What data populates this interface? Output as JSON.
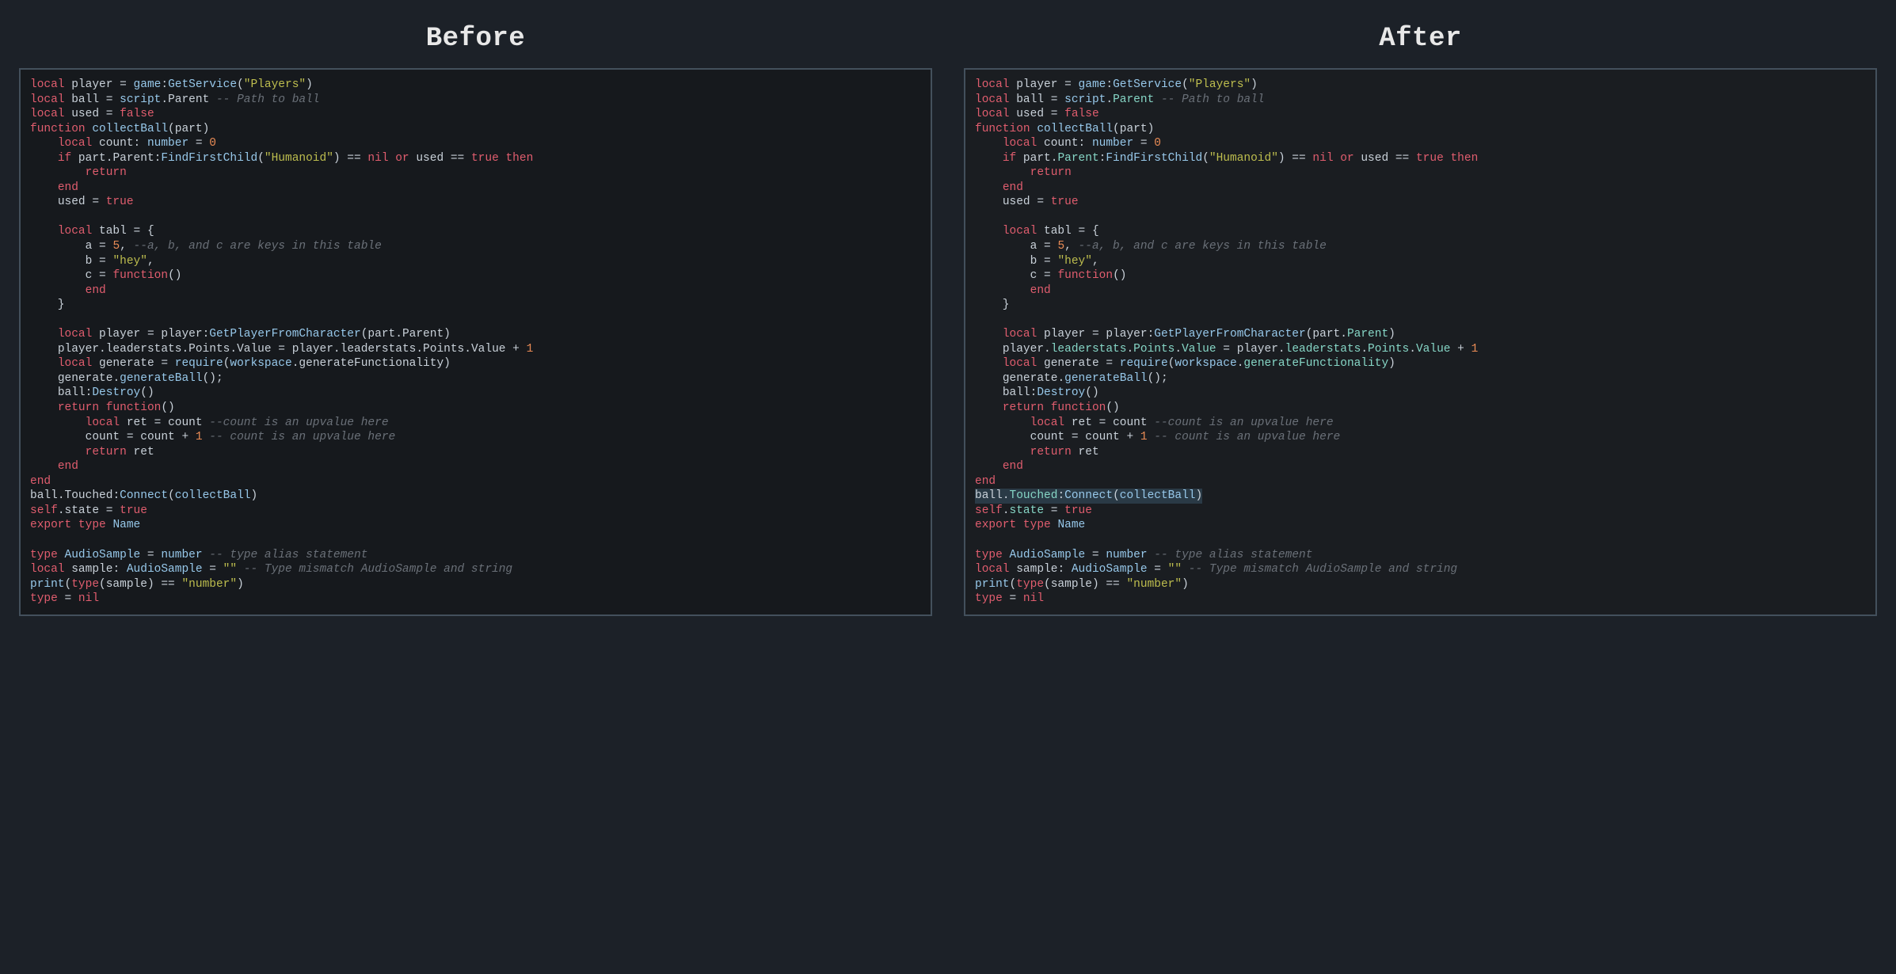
{
  "headings": {
    "before": "Before",
    "after": "After"
  },
  "code_before": {
    "colors": {
      "keyword": "#e05d6e",
      "string": "#bdbd4e",
      "number": "#e98b55",
      "comment": "#6a7078",
      "func": "#97c8ea",
      "default": "#c9d1d9"
    },
    "lines": [
      "local player = game:GetService(\"Players\")",
      "local ball = script.Parent -- Path to ball",
      "local used = false",
      "function collectBall(part)",
      "    local count: number = 0",
      "    if part.Parent:FindFirstChild(\"Humanoid\") == nil or used == true then",
      "        return",
      "    end",
      "    used = true",
      "",
      "    local tabl = {",
      "        a = 5, --a, b, and c are keys in this table",
      "        b = \"hey\",",
      "        c = function()",
      "        end",
      "    }",
      "",
      "    local player = player:GetPlayerFromCharacter(part.Parent)",
      "    player.leaderstats.Points.Value = player.leaderstats.Points.Value + 1",
      "    local generate = require(workspace.generateFunctionality)",
      "    generate.generateBall();",
      "    ball:Destroy()",
      "    return function()",
      "        local ret = count --count is an upvalue here",
      "        count = count + 1 -- count is an upvalue here",
      "        return ret",
      "    end",
      "end",
      "ball.Touched:Connect(collectBall)",
      "self.state = true",
      "export type Name",
      "",
      "type AudioSample = number -- type alias statement",
      "local sample: AudioSample = \"\" -- Type mismatch AudioSample and string",
      "print(type(sample) == \"number\")",
      "type = nil"
    ]
  },
  "code_after": {
    "colors": {
      "keyword": "#e05d6e",
      "string": "#bdbd4e",
      "number": "#e98b55",
      "comment": "#6a7078",
      "func": "#97c8ea",
      "property": "#86d6c6",
      "default": "#c9d1d9"
    },
    "highlighted_line_index": 28,
    "lines": [
      "local player = game:GetService(\"Players\")",
      "local ball = script.Parent -- Path to ball",
      "local used = false",
      "function collectBall(part)",
      "    local count: number = 0",
      "    if part.Parent:FindFirstChild(\"Humanoid\") == nil or used == true then",
      "        return",
      "    end",
      "    used = true",
      "",
      "    local tabl = {",
      "        a = 5, --a, b, and c are keys in this table",
      "        b = \"hey\",",
      "        c = function()",
      "        end",
      "    }",
      "",
      "    local player = player:GetPlayerFromCharacter(part.Parent)",
      "    player.leaderstats.Points.Value = player.leaderstats.Points.Value + 1",
      "    local generate = require(workspace.generateFunctionality)",
      "    generate.generateBall();",
      "    ball:Destroy()",
      "    return function()",
      "        local ret = count --count is an upvalue here",
      "        count = count + 1 -- count is an upvalue here",
      "        return ret",
      "    end",
      "end",
      "ball.Touched:Connect(collectBall)",
      "self.state = true",
      "export type Name",
      "",
      "type AudioSample = number -- type alias statement",
      "local sample: AudioSample = \"\" -- Type mismatch AudioSample and string",
      "print(type(sample) == \"number\")",
      "type = nil"
    ]
  }
}
